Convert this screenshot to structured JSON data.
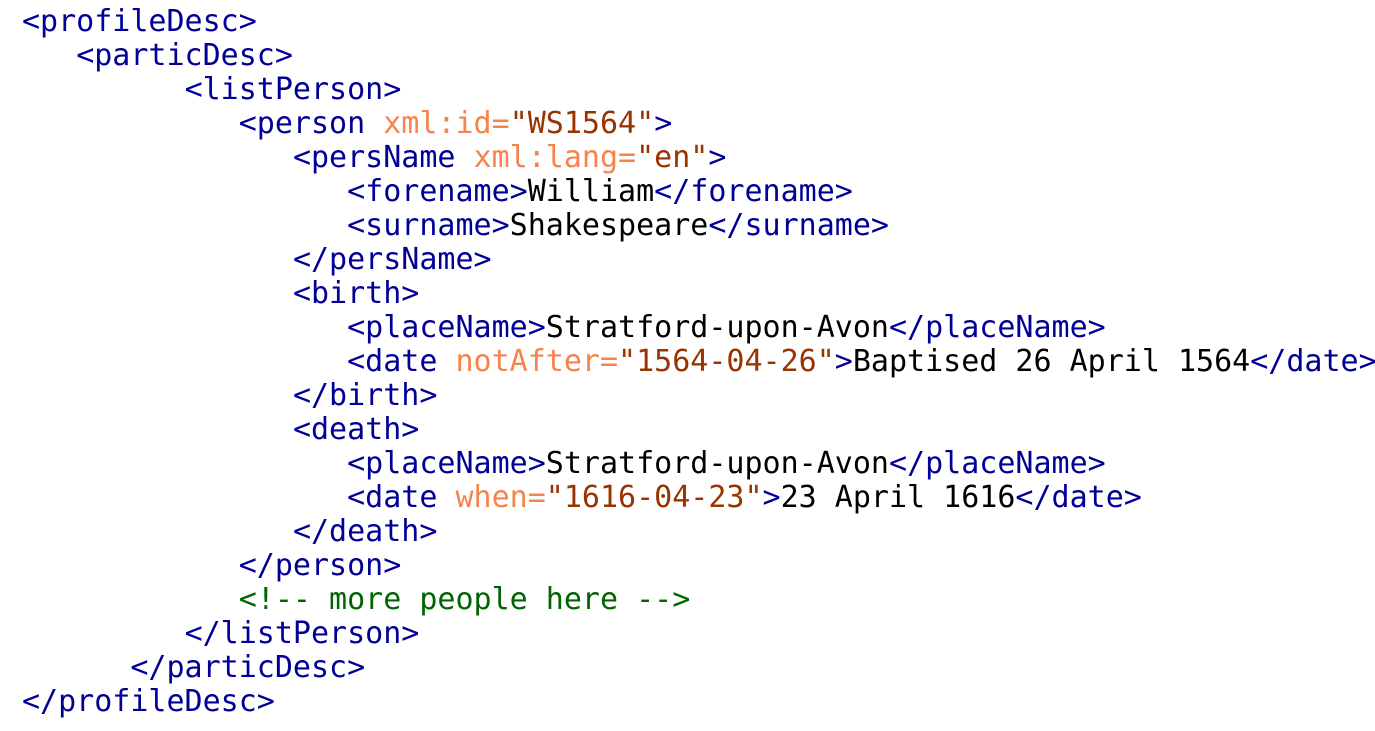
{
  "colors": {
    "tag": "#000096",
    "attribute_name": "#f5844c",
    "attribute_value": "#993300",
    "text": "#000000",
    "comment": "#006400",
    "background": "#ffffff"
  },
  "lines": [
    {
      "indent": "",
      "tokens": [
        {
          "t": "tag",
          "v": "<profileDesc>"
        }
      ]
    },
    {
      "indent": "   ",
      "tokens": [
        {
          "t": "tag",
          "v": "<particDesc>"
        }
      ]
    },
    {
      "indent": "         ",
      "tokens": [
        {
          "t": "tag",
          "v": "<listPerson>"
        }
      ]
    },
    {
      "indent": "            ",
      "tokens": [
        {
          "t": "tag",
          "v": "<person "
        },
        {
          "t": "attr",
          "v": "xml:id="
        },
        {
          "t": "val",
          "v": "\"WS1564\""
        },
        {
          "t": "tag",
          "v": ">"
        }
      ]
    },
    {
      "indent": "               ",
      "tokens": [
        {
          "t": "tag",
          "v": "<persName "
        },
        {
          "t": "attr",
          "v": "xml:lang="
        },
        {
          "t": "val",
          "v": "\"en\""
        },
        {
          "t": "tag",
          "v": ">"
        }
      ]
    },
    {
      "indent": "                  ",
      "tokens": [
        {
          "t": "tag",
          "v": "<forename>"
        },
        {
          "t": "text",
          "v": "William"
        },
        {
          "t": "tag",
          "v": "</forename>"
        }
      ]
    },
    {
      "indent": "                  ",
      "tokens": [
        {
          "t": "tag",
          "v": "<surname>"
        },
        {
          "t": "text",
          "v": "Shakespeare"
        },
        {
          "t": "tag",
          "v": "</surname>"
        }
      ]
    },
    {
      "indent": "               ",
      "tokens": [
        {
          "t": "tag",
          "v": "</persName>"
        }
      ]
    },
    {
      "indent": "               ",
      "tokens": [
        {
          "t": "tag",
          "v": "<birth>"
        }
      ]
    },
    {
      "indent": "                  ",
      "tokens": [
        {
          "t": "tag",
          "v": "<placeName>"
        },
        {
          "t": "text",
          "v": "Stratford-upon-Avon"
        },
        {
          "t": "tag",
          "v": "</placeName>"
        }
      ]
    },
    {
      "indent": "                  ",
      "tokens": [
        {
          "t": "tag",
          "v": "<date "
        },
        {
          "t": "attr",
          "v": "notAfter="
        },
        {
          "t": "val",
          "v": "\"1564-04-26\""
        },
        {
          "t": "tag",
          "v": ">"
        },
        {
          "t": "text",
          "v": "Baptised 26 April 1564"
        },
        {
          "t": "tag",
          "v": "</date>"
        }
      ]
    },
    {
      "indent": "               ",
      "tokens": [
        {
          "t": "tag",
          "v": "</birth>"
        }
      ]
    },
    {
      "indent": "               ",
      "tokens": [
        {
          "t": "tag",
          "v": "<death>"
        }
      ]
    },
    {
      "indent": "                  ",
      "tokens": [
        {
          "t": "tag",
          "v": "<placeName>"
        },
        {
          "t": "text",
          "v": "Stratford-upon-Avon"
        },
        {
          "t": "tag",
          "v": "</placeName>"
        }
      ]
    },
    {
      "indent": "                  ",
      "tokens": [
        {
          "t": "tag",
          "v": "<date "
        },
        {
          "t": "attr",
          "v": "when="
        },
        {
          "t": "val",
          "v": "\"1616-04-23\""
        },
        {
          "t": "tag",
          "v": ">"
        },
        {
          "t": "text",
          "v": "23 April 1616"
        },
        {
          "t": "tag",
          "v": "</date>"
        }
      ]
    },
    {
      "indent": "               ",
      "tokens": [
        {
          "t": "tag",
          "v": "</death>"
        }
      ]
    },
    {
      "indent": "            ",
      "tokens": [
        {
          "t": "tag",
          "v": "</person>"
        }
      ]
    },
    {
      "indent": "            ",
      "tokens": [
        {
          "t": "comment",
          "v": "<!-- more people here -->"
        }
      ]
    },
    {
      "indent": "         ",
      "tokens": [
        {
          "t": "tag",
          "v": "</listPerson>"
        }
      ]
    },
    {
      "indent": "      ",
      "tokens": [
        {
          "t": "tag",
          "v": "</particDesc>"
        }
      ]
    },
    {
      "indent": "",
      "tokens": [
        {
          "t": "tag",
          "v": "</profileDesc>"
        }
      ]
    }
  ]
}
